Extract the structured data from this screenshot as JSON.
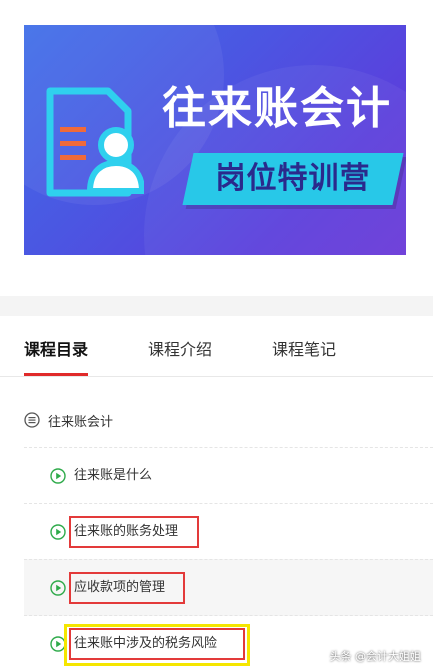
{
  "banner": {
    "title": "往来账会计",
    "subtitle": "岗位特训营",
    "icon": "profile-document-icon"
  },
  "tabs": [
    {
      "label": "课程目录",
      "active": true
    },
    {
      "label": "课程介绍",
      "active": false
    },
    {
      "label": "课程笔记",
      "active": false
    }
  ],
  "chapter": {
    "label": "往来账会计",
    "icon": "list-icon"
  },
  "lessons": [
    {
      "label": "往来账是什么",
      "icon": "play-icon"
    },
    {
      "label": "往来账的账务处理",
      "icon": "play-icon"
    },
    {
      "label": "应收款项的管理",
      "icon": "play-icon"
    },
    {
      "label": "往来账中涉及的税务风险",
      "icon": "play-icon"
    }
  ],
  "watermark": "头条 @会计大姐姐",
  "colors": {
    "accent": "#e02a2a",
    "play": "#2eaa4a",
    "highlight_red": "#e33a3a",
    "highlight_yellow": "#f5e600",
    "banner_cyan": "#28c8e8"
  }
}
